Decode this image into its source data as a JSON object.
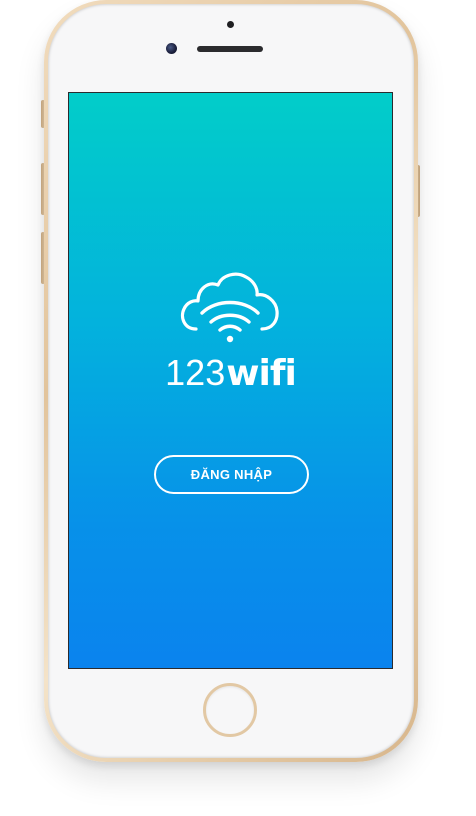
{
  "brand": {
    "number": "123",
    "word": "wifi",
    "logo_icon": "cloud-wifi-icon"
  },
  "login": {
    "label": "ĐĂNG NHẬP"
  },
  "device": {
    "frame": "gold",
    "home_icon": "home-button-icon"
  },
  "colors": {
    "gradient_top": "#02cdc9",
    "gradient_bottom": "#0a83ee",
    "text": "#ffffff",
    "frame_gold": "#e2c49c",
    "bezel": "#f7f7f8"
  }
}
